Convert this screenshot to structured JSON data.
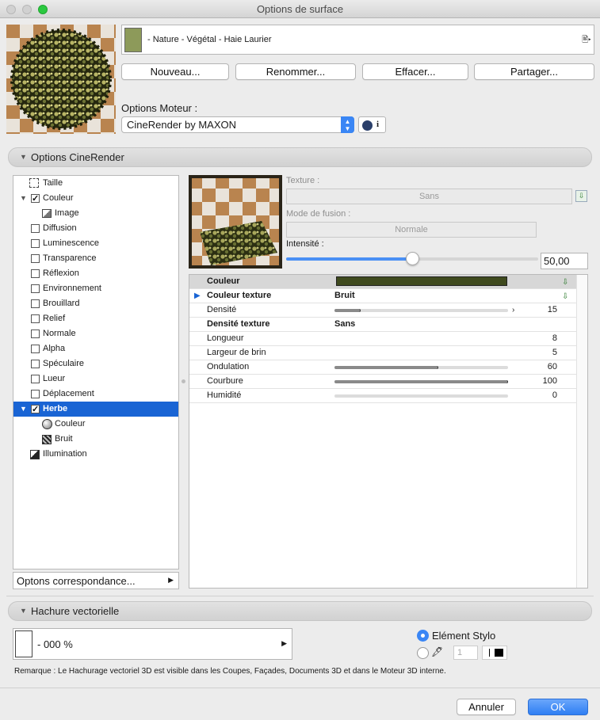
{
  "window": {
    "title": "Options de surface"
  },
  "material": {
    "name": "- Nature - Végétal - Haie Laurier",
    "swatch_color": "#8d9a5a"
  },
  "buttons": {
    "new": "Nouveau...",
    "rename": "Renommer...",
    "delete": "Effacer...",
    "share": "Partager..."
  },
  "engine": {
    "label": "Options Moteur :",
    "selected": "CineRender by MAXON"
  },
  "cinerender": {
    "header": "Options CineRender"
  },
  "tree": {
    "items": [
      {
        "label": "Taille"
      },
      {
        "label": "Couleur"
      },
      {
        "label": "Image"
      },
      {
        "label": "Diffusion"
      },
      {
        "label": "Luminescence"
      },
      {
        "label": "Transparence"
      },
      {
        "label": "Réflexion"
      },
      {
        "label": "Environnement"
      },
      {
        "label": "Brouillard"
      },
      {
        "label": "Relief"
      },
      {
        "label": "Normale"
      },
      {
        "label": "Alpha"
      },
      {
        "label": "Spéculaire"
      },
      {
        "label": "Lueur"
      },
      {
        "label": "Déplacement"
      },
      {
        "label": "Herbe"
      },
      {
        "label": "Couleur"
      },
      {
        "label": "Bruit"
      },
      {
        "label": "Illumination"
      }
    ],
    "footer": "Optons correspondance..."
  },
  "texture": {
    "texture_label": "Texture :",
    "texture_value": "Sans",
    "blend_label": "Mode de fusion :",
    "blend_value": "Normale",
    "intensity_label": "Intensité :",
    "intensity_value": "50,00",
    "intensity_fraction": 0.5
  },
  "props": {
    "color_label": "Couleur",
    "color_value": "#3f4a1e",
    "color_texture_label": "Couleur texture",
    "color_texture_value": "Bruit",
    "density_label": "Densité",
    "density_value": "15",
    "density_fraction": 0.15,
    "density_texture_label": "Densité texture",
    "density_texture_value": "Sans",
    "length_label": "Longueur",
    "length_value": "8",
    "width_label": "Largeur de brin",
    "width_value": "5",
    "wave_label": "Ondulation",
    "wave_value": "60",
    "wave_fraction": 0.6,
    "bend_label": "Courbure",
    "bend_value": "100",
    "bend_fraction": 1.0,
    "humidity_label": "Humidité",
    "humidity_value": "0",
    "humidity_fraction": 0.0
  },
  "hatch": {
    "header": "Hachure vectorielle",
    "pattern": "- 000 %",
    "pen_label": "Elément Stylo",
    "pen_number": "1",
    "note": "Remarque : Le Hachurage vectoriel 3D est visible dans les Coupes, Façades, Documents 3D et dans le Moteur 3D interne."
  },
  "footer": {
    "cancel": "Annuler",
    "ok": "OK"
  },
  "colors": {
    "accent": "#1964d4",
    "ok_button": "#3d8af7"
  }
}
